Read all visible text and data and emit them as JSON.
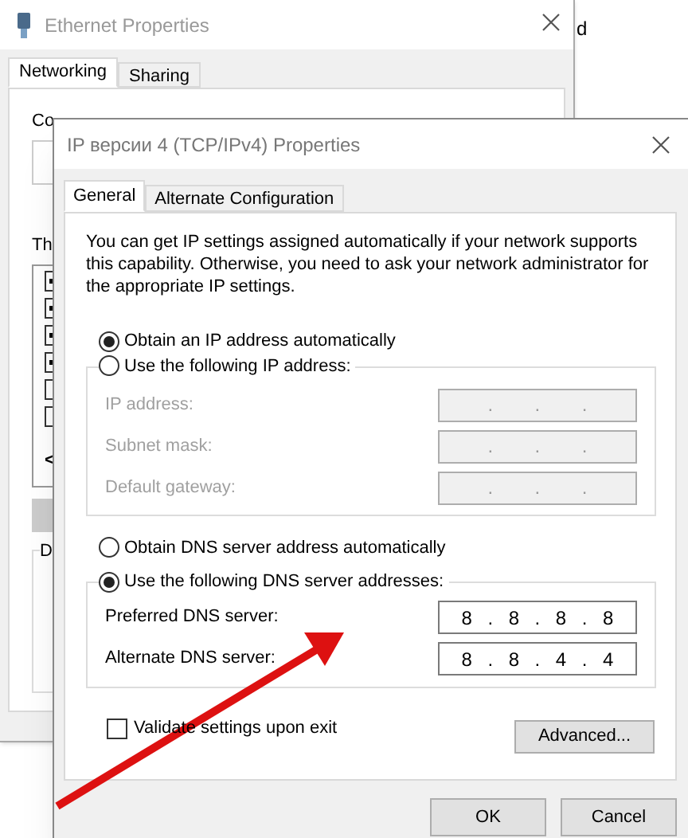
{
  "desktop_text": "d",
  "background_window": {
    "title": "Ethernet Properties",
    "tabs": [
      {
        "label": "Networking",
        "selected": true
      },
      {
        "label": "Sharing",
        "selected": false
      }
    ],
    "label_1": "Co",
    "label_2": "Th",
    "items": [
      {
        "checked": true
      },
      {
        "checked": true
      },
      {
        "checked": true
      },
      {
        "checked": true
      },
      {
        "checked": false
      },
      {
        "checked": false
      }
    ],
    "scroll_arrow": "<",
    "group_label": "D"
  },
  "dialog": {
    "title": "IP версии 4 (TCP/IPv4) Properties",
    "tabs": [
      {
        "label": "General",
        "selected": true
      },
      {
        "label": "Alternate Configuration",
        "selected": false
      }
    ],
    "description": "You can get IP settings assigned automatically if your network supports this capability. Otherwise, you need to ask your network administrator for the appropriate IP settings.",
    "separator": ".",
    "ip_options": [
      {
        "label": "Obtain an IP address automatically",
        "selected": true
      },
      {
        "label": "Use the following IP address:",
        "selected": false
      }
    ],
    "ip_fields": [
      {
        "label": "IP address:",
        "disabled": true
      },
      {
        "label": "Subnet mask:",
        "disabled": true
      },
      {
        "label": "Default gateway:",
        "disabled": true
      }
    ],
    "dns_options": [
      {
        "label": "Obtain DNS server address automatically",
        "selected": false
      },
      {
        "label": "Use the following DNS server addresses:",
        "selected": true
      }
    ],
    "dns_fields": [
      {
        "label": "Preferred DNS server:",
        "disabled": false,
        "octets": [
          "8",
          "8",
          "8",
          "8"
        ]
      },
      {
        "label": "Alternate DNS server:",
        "disabled": false,
        "octets": [
          "8",
          "8",
          "4",
          "4"
        ]
      }
    ],
    "validate": {
      "label": "Validate settings upon exit",
      "checked": false
    },
    "advanced_button": "Advanced...",
    "buttons": [
      "OK",
      "Cancel"
    ]
  }
}
